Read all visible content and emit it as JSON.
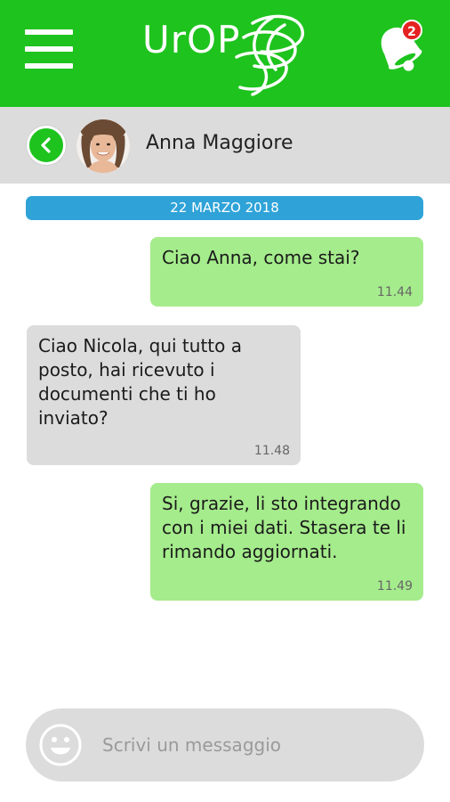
{
  "header": {
    "logo_text": "UrOP",
    "notification_count": "2",
    "background_color": "#1ec31e",
    "menu_icon": "hamburger-menu-icon",
    "notification_icon": "bell-icon"
  },
  "contact": {
    "name": "Anna Maggiore",
    "back_icon": "chevron-left-icon"
  },
  "conversation": {
    "date_label": "22 MARZO 2018",
    "messages": [
      {
        "direction": "outgoing",
        "text": "Ciao Anna, come stai?",
        "time": "11.44"
      },
      {
        "direction": "incoming",
        "text": "Ciao Nicola, qui tutto a posto, hai ricevuto i documenti che ti ho inviato?",
        "time": "11.48"
      },
      {
        "direction": "outgoing",
        "text": "Si, grazie, li sto integrando con i miei dati. Stasera te li rimando aggiornati.",
        "time": "11.49"
      }
    ]
  },
  "composer": {
    "placeholder": "Scrivi un messaggio",
    "value": "",
    "emoji_icon": "smiley-icon"
  },
  "colors": {
    "accent_green": "#1ec31e",
    "outgoing_bubble": "#a5ec8c",
    "incoming_bubble": "#dcdcdc",
    "date_pill": "#2fa3d8",
    "badge_red": "#e52222"
  }
}
